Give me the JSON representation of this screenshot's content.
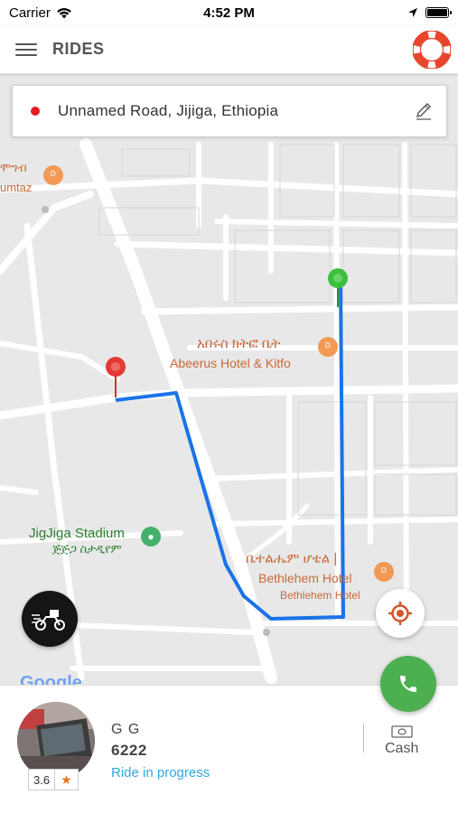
{
  "status_bar": {
    "carrier": "Carrier",
    "time": "4:52 PM",
    "battery_level": 1.0
  },
  "nav": {
    "title": "RIDES",
    "menu_icon": "hamburger-menu-icon",
    "help_icon": "lifebuoy-icon"
  },
  "address": {
    "text": "Unnamed Road, Jijiga, Ethiopia",
    "edit_icon": "pencil-icon"
  },
  "map": {
    "labels": {
      "top_left_amharic": "ሞግብ",
      "top_left_latin": "umtaz",
      "abeerus_amharic": "አበሩስ ክትፎ ቤት",
      "abeerus_latin": "Abeerus Hotel & Kitfo",
      "stadium_latin": "JigJiga Stadium",
      "stadium_amharic": "ጅጅጋ ስታዲየም",
      "bethlehem_amharic": "ቤተልሔም ሆቴል |",
      "bethlehem_latin_1": "Bethlehem Hotel",
      "bethlehem_latin_2": "Bethlehem Hotel",
      "google": "Google"
    },
    "route_color": "#1a73e8",
    "origin_marker_color": "#3cc03c",
    "destination_marker_color": "#e53935"
  },
  "actions": {
    "moto_icon": "motorcycle-delivery-icon",
    "locate_icon": "crosshair-location-icon",
    "call_icon": "phone-icon"
  },
  "driver": {
    "name": "G G",
    "plate": "6222",
    "status": "Ride in progress",
    "rating": "3.6",
    "rating_icon": "star-icon"
  },
  "payment": {
    "method": "Cash",
    "icon": "banknote-icon"
  },
  "colors": {
    "status_link": "#30a9de",
    "call_button": "#4caf50",
    "accent_red": "#e51c23",
    "star": "#e4761c"
  }
}
